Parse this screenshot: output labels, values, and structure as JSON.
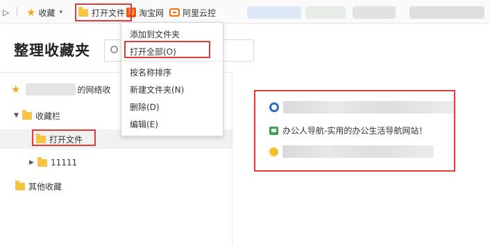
{
  "bookmarks_bar": {
    "overflow_glyph": "▷",
    "favorites_label": "收藏",
    "open_file_label": "打开文件",
    "taobao_icon_text": "淘",
    "taobao_label": "淘宝网",
    "aliyun_label": "阿里云控"
  },
  "page": {
    "title": "整理收藏夹",
    "search_placeholder": ""
  },
  "sidebar": {
    "account_suffix": "的网络收",
    "items": [
      {
        "label": "收藏栏",
        "expanded": true
      },
      {
        "label": "打开文件",
        "selected": true
      },
      {
        "label": "11111",
        "expanded": false
      },
      {
        "label": "其他收藏"
      }
    ]
  },
  "content": {
    "bookmarks": [
      {
        "label": "",
        "icon": "q-icon"
      },
      {
        "label": "办公人导航-实用的办公生活导航网站！",
        "icon": "monitor-icon"
      },
      {
        "label": "",
        "icon": "yellow-icon"
      }
    ]
  },
  "context_menu": {
    "items": [
      "添加到文件夹",
      "打开全部(O)",
      "按名称排序",
      "新建文件夹(N)",
      "删除(D)",
      "编辑(E)"
    ]
  },
  "colors": {
    "highlight": "#e23a3a",
    "folder": "#f6c443",
    "star": "#f5a623"
  }
}
